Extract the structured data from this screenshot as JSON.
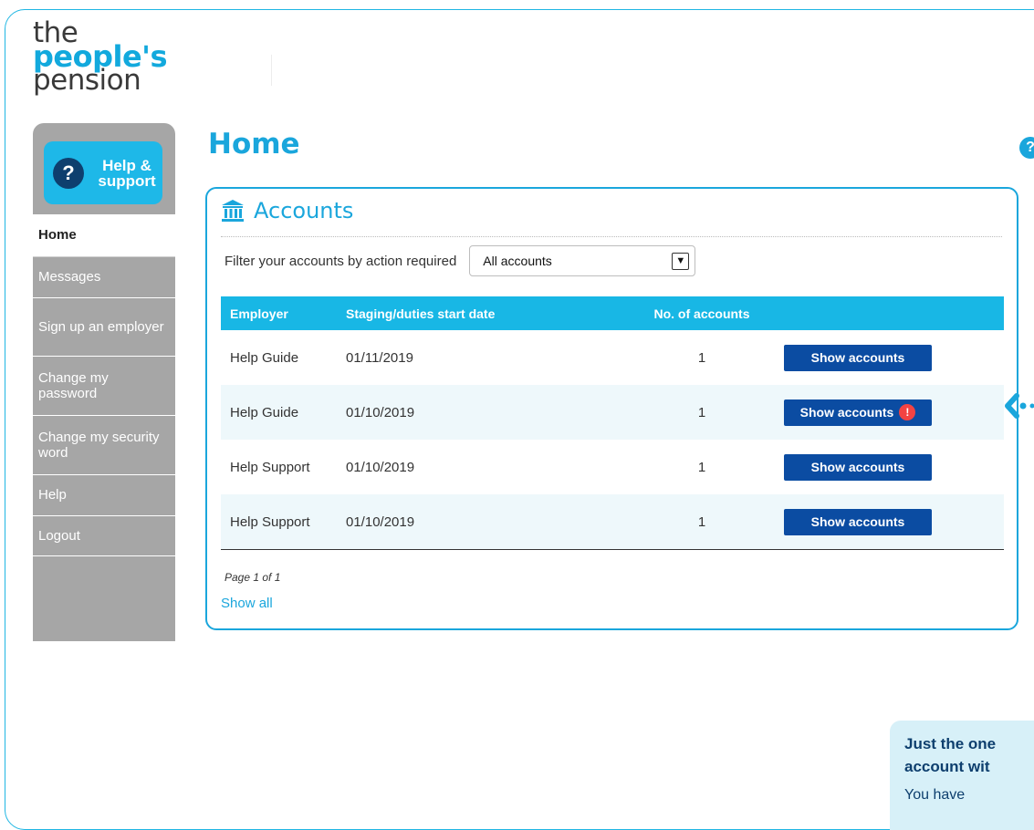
{
  "brand": {
    "line1": "the",
    "line2": "people's",
    "line3": "pension"
  },
  "sidebar": {
    "help_button": {
      "icon_text": "?",
      "label": "Help & support"
    },
    "items": [
      {
        "label": "Home",
        "active": true
      },
      {
        "label": "Messages"
      },
      {
        "label": "Sign up an employer"
      },
      {
        "label": "Change my password"
      },
      {
        "label": "Change my security word"
      },
      {
        "label": "Help"
      },
      {
        "label": "Logout"
      }
    ]
  },
  "page": {
    "title": "Home",
    "help_icon_text": "?"
  },
  "accounts": {
    "title": "Accounts",
    "filter_label": "Filter your accounts by action required",
    "filter_selected": "All accounts",
    "columns": [
      "Employer",
      "Staging/duties start date",
      "No. of accounts",
      ""
    ],
    "rows": [
      {
        "employer": "Help Guide",
        "date": "01/11/2019",
        "count": "1",
        "action": "Show accounts",
        "alert": false
      },
      {
        "employer": "Help Guide",
        "date": "01/10/2019",
        "count": "1",
        "action": "Show accounts",
        "alert": true
      },
      {
        "employer": "Help Support",
        "date": "01/10/2019",
        "count": "1",
        "action": "Show accounts",
        "alert": false
      },
      {
        "employer": "Help Support",
        "date": "01/10/2019",
        "count": "1",
        "action": "Show accounts",
        "alert": false
      }
    ],
    "alert_icon_text": "!",
    "page_info": "Page 1 of 1",
    "show_all": "Show all"
  },
  "tip": {
    "title_line1": "Just the one",
    "title_line2": "account wit",
    "body": "You have"
  },
  "colors": {
    "brand_blue": "#1aa6dc",
    "header_blue": "#18b7e5",
    "button_navy": "#0b4ca2",
    "alert_red": "#f24343",
    "sidebar_grey": "#a6a6a6"
  }
}
